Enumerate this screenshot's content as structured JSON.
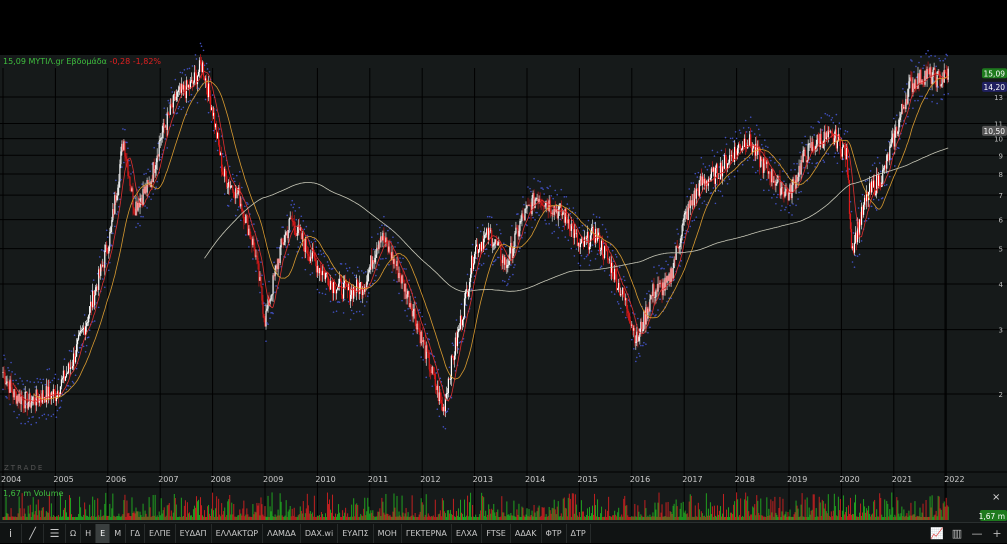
{
  "header": {
    "price": "15,09",
    "symbol": "ΜΥΤΙΛ.gr",
    "period": "Εβδομάδα",
    "change": "-0,28",
    "change_pct": "-1,82%"
  },
  "watermark": "ZTRADE",
  "price_tags": {
    "last": "15,09",
    "ma": "14,20",
    "ma_long": "10,50",
    "volume": "1,67 m"
  },
  "volume_label": "1,67 m Volume",
  "colors": {
    "up": "#ffffff",
    "down": "#e01818",
    "ma_short": "#e03030",
    "ma_mid": "#d89a30",
    "ma_long": "#c8c8b8",
    "sar": "#4050c0",
    "grid": "#000000",
    "last_tag": "#1e7a1e",
    "ma_tag": "#202060",
    "vol_up": "#20a020",
    "vol_down": "#c02020"
  },
  "toolbar": {
    "icons": [
      "info-icon",
      "draw-line-icon",
      "indicators-icon"
    ],
    "items": [
      "Ω",
      "Η",
      "Ε",
      "Μ",
      "ΓΔ",
      "ΕΛΠΕ",
      "ΕΥΔΑΠ",
      "ΕΛΛΑΚΤΩΡ",
      "ΛΑΜΔΑ",
      "DAX.wi",
      "ΕΥΑΠΣ",
      "ΜΟΗ",
      "ΓΕΚΤΕΡΝΑ",
      "ΕΛΧΑ",
      "FTSE",
      "ΑΔΑΚ",
      "ΦΤΡ",
      "ΔΤΡ"
    ],
    "active": "Ε",
    "right_icons": [
      "chart-type-icon",
      "bar-chart-icon",
      "zoom-out-icon",
      "zoom-in-icon"
    ],
    "right_glyphs": [
      "📈",
      "▥",
      "—",
      "+"
    ]
  },
  "close_glyph": "×",
  "chart_data": {
    "type": "candlestick",
    "scale": "log",
    "ylim": [
      1.7,
      17
    ],
    "yticks": [
      2,
      3,
      4,
      5,
      6,
      7,
      8,
      9,
      10,
      11,
      13
    ],
    "xticks": [
      "2004",
      "2005",
      "2006",
      "2007",
      "2008",
      "2009",
      "2010",
      "2011",
      "2012",
      "2013",
      "2014",
      "2015",
      "2016",
      "2017",
      "2018",
      "2019",
      "2020",
      "2021",
      "2022"
    ],
    "grid": true,
    "approx_close": [
      [
        2004.0,
        2.3
      ],
      [
        2004.2,
        2.0
      ],
      [
        2004.5,
        1.9
      ],
      [
        2004.8,
        2.0
      ],
      [
        2005.0,
        2.0
      ],
      [
        2005.3,
        2.4
      ],
      [
        2005.6,
        3.2
      ],
      [
        2005.9,
        4.5
      ],
      [
        2006.05,
        5.5
      ],
      [
        2006.3,
        10
      ],
      [
        2006.5,
        6.5
      ],
      [
        2006.8,
        7.5
      ],
      [
        2007.0,
        10
      ],
      [
        2007.3,
        13
      ],
      [
        2007.6,
        14
      ],
      [
        2007.8,
        16
      ],
      [
        2008.0,
        12
      ],
      [
        2008.2,
        8
      ],
      [
        2008.5,
        7
      ],
      [
        2008.8,
        5
      ],
      [
        2009.0,
        3.2
      ],
      [
        2009.3,
        5
      ],
      [
        2009.5,
        6
      ],
      [
        2009.8,
        5
      ],
      [
        2010.0,
        4.5
      ],
      [
        2010.3,
        4
      ],
      [
        2010.6,
        3.8
      ],
      [
        2010.9,
        4
      ],
      [
        2011.2,
        5.5
      ],
      [
        2011.5,
        4.5
      ],
      [
        2011.8,
        3.5
      ],
      [
        2012.0,
        2.8
      ],
      [
        2012.4,
        1.8
      ],
      [
        2012.5,
        2.2
      ],
      [
        2012.8,
        3.5
      ],
      [
        2013.0,
        5
      ],
      [
        2013.3,
        5.5
      ],
      [
        2013.6,
        4.5
      ],
      [
        2013.9,
        6
      ],
      [
        2014.2,
        7
      ],
      [
        2014.5,
        6.5
      ],
      [
        2014.8,
        6
      ],
      [
        2015.0,
        5
      ],
      [
        2015.3,
        5.5
      ],
      [
        2015.6,
        4.5
      ],
      [
        2015.9,
        3.5
      ],
      [
        2016.1,
        2.8
      ],
      [
        2016.4,
        3.8
      ],
      [
        2016.7,
        4
      ],
      [
        2017.0,
        6
      ],
      [
        2017.3,
        7.5
      ],
      [
        2017.6,
        8
      ],
      [
        2017.9,
        9
      ],
      [
        2018.2,
        10
      ],
      [
        2018.5,
        8.5
      ],
      [
        2018.8,
        7.5
      ],
      [
        2019.0,
        7
      ],
      [
        2019.3,
        9
      ],
      [
        2019.6,
        10
      ],
      [
        2019.9,
        10
      ],
      [
        2020.1,
        9
      ],
      [
        2020.2,
        5
      ],
      [
        2020.5,
        7
      ],
      [
        2020.8,
        8
      ],
      [
        2021.0,
        10
      ],
      [
        2021.3,
        14
      ],
      [
        2021.6,
        15
      ],
      [
        2021.9,
        14.5
      ],
      [
        2022.05,
        15.09
      ]
    ]
  }
}
